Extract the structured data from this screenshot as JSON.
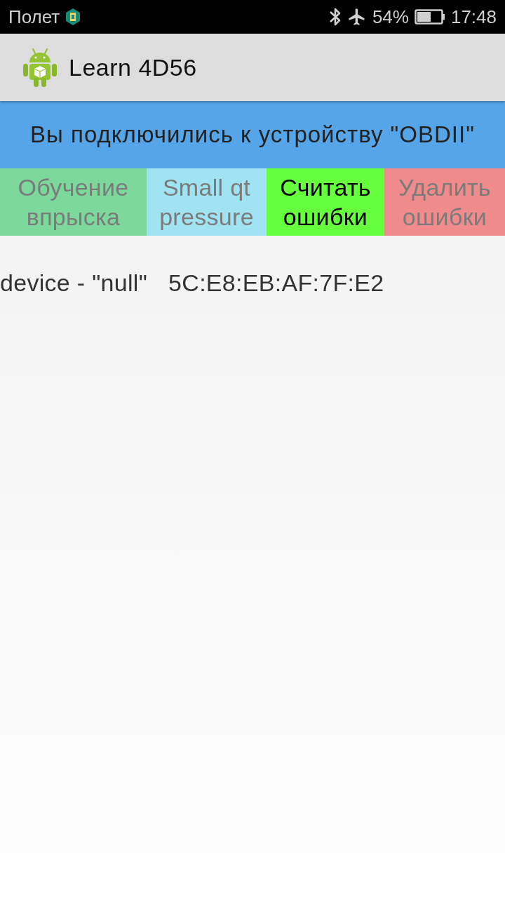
{
  "status_bar": {
    "carrier": "Полет",
    "battery": "54%",
    "time": "17:48"
  },
  "app_bar": {
    "title": "Learn 4D56"
  },
  "banner": {
    "text": "Вы подключились к устройству \"OBDII\""
  },
  "buttons": [
    {
      "label": "Обучение впрыска",
      "disabled": true,
      "color": "#7dd99b"
    },
    {
      "label": "Small qt pressure",
      "disabled": true,
      "color": "#a0e3f2"
    },
    {
      "label": "Считать ошибки",
      "disabled": false,
      "color": "#66ff3d"
    },
    {
      "label": "Удалить ошибки",
      "disabled": true,
      "color": "#f08b8b"
    }
  ],
  "devices": [
    {
      "name": "device - \"null\"",
      "address": "5C:E8:EB:AF:7F:E2"
    }
  ]
}
